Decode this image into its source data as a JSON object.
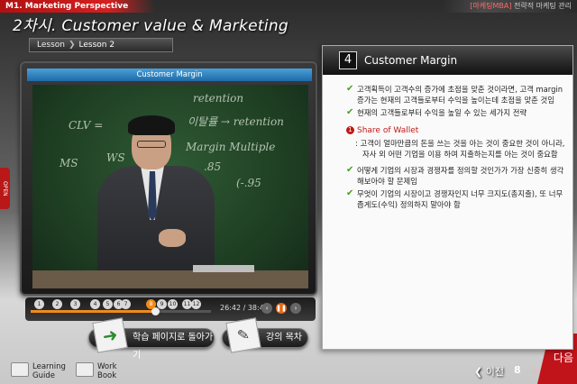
{
  "header": {
    "module": "M1. Marketing Perspective",
    "brand": "[마케팅MBA]",
    "brand_sub": " 전략적 마케팅 관리",
    "lecture_title": "2차시. Customer value & Marketing",
    "breadcrumb": {
      "lesson": "Lesson",
      "separator": "❯",
      "current": "Lesson 2"
    }
  },
  "video": {
    "title": "Customer Margin",
    "board_texts": [
      "retention",
      "CLV =",
      "이탈률 → retention",
      "Margin Multiple",
      "MS",
      "WS",
      ".85",
      "(-.95"
    ]
  },
  "playbar": {
    "chapters": [
      "1",
      "2",
      "3",
      "4",
      "5",
      "6",
      "7",
      "8",
      "9",
      "10",
      "11",
      "12"
    ],
    "active_chapter": "8",
    "time": "26:42 / 38:48",
    "progress": 0.69
  },
  "buttons": {
    "back_to_learning": "학습 페이지로 돌아가기",
    "lecture_content": "강의 목차"
  },
  "footer": {
    "learning_guide": [
      "Learning",
      "Guide"
    ],
    "work_book": [
      "Work",
      "Book"
    ],
    "open_tab": "OPEN",
    "prev": "❮ 이전",
    "page": "8",
    "total": "/12",
    "next": "다음"
  },
  "panel": {
    "number": "4",
    "title": "Customer Margin",
    "items": [
      "고객획득이 고객수의 증가에 초점을 맞춘 것이라면, 고객 margin 증가는 현재의 고객들로부터 수익을 높이는데 초점을 맞춘 것임",
      "현재의 고객들로부터 수익을 높일 수 있는 세가지 전략"
    ],
    "share_of_wallet": {
      "head": "Share of Wallet",
      "text": ": 고객이 얼마만큼의 돈을 쓰는 것을 아는 것이 중요한 것이 아니라, 자사 외 어떤 기업을 이용 하여 지출하는지를 아는 것이 중요함"
    },
    "items2": [
      "어떻게 기업의 시장과 경쟁자를 정의할 것인가가 가장 신중히 생각해보아야 할 문제임",
      "무엇이 기업의 시장이고 경쟁자인지 너무 크지도(총지출), 또 너무 좁게도(수익) 정의하지 말아야 함"
    ]
  },
  "colors": {
    "accent_red": "#c01818",
    "check_green": "#46a01e",
    "progress_orange": "#f08a1a",
    "title_bar_blue": "#1e6aa8"
  }
}
